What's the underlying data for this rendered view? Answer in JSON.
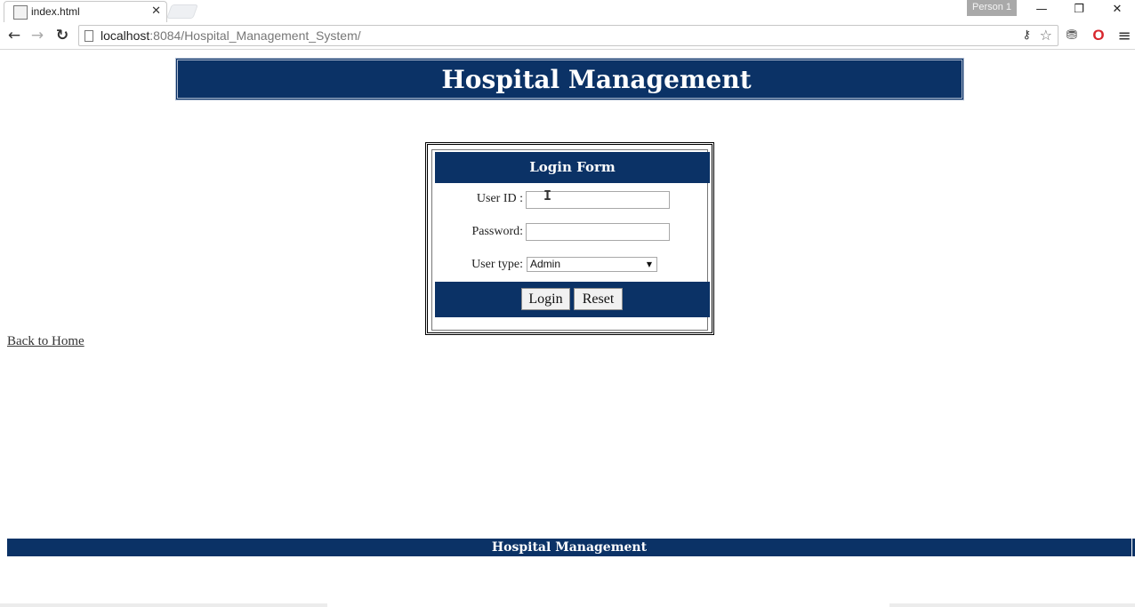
{
  "browser": {
    "tab_title": "index.html",
    "tab_close": "✕",
    "profile_name": "Person 1",
    "url_host": "localhost",
    "url_path": ":8084/Hospital_Management_System/",
    "icons": {
      "back": "←",
      "forward": "→",
      "reload": "↻",
      "key": "⚷",
      "star": "☆",
      "extension": "⛃",
      "opera": "O",
      "menu": "≡",
      "minimize": "—",
      "restore": "❐",
      "close": "✕"
    }
  },
  "header": {
    "title": "Hospital Management"
  },
  "login_form": {
    "title": "Login Form",
    "user_id_label": "User ID :",
    "user_id_value": "",
    "password_label": "Password:",
    "password_value": "",
    "user_type_label": "User type:",
    "user_type_selected": "Admin",
    "select_arrow": "▼",
    "login_button": "Login",
    "reset_button": "Reset"
  },
  "back_link": "Back to Home",
  "footer": {
    "text": "Hospital Management"
  },
  "colors": {
    "navy": "#0b3266",
    "white": "#ffffff"
  }
}
